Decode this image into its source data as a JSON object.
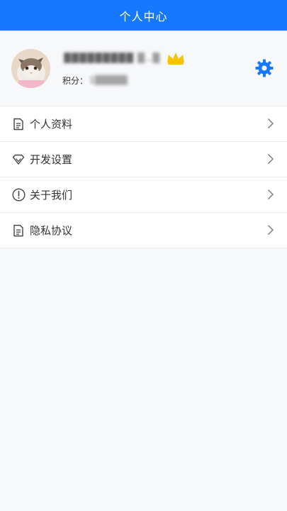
{
  "header": {
    "title": "个人中心",
    "color": "#1677ff"
  },
  "profile": {
    "username": "▓▓▓▓▓▓▓▓▓ ▒..▒",
    "points_label": "积分：",
    "points_value": "1▒▒▒▒▒",
    "vip_icon": "crown-icon",
    "settings_icon": "gear-icon"
  },
  "menu": {
    "items": [
      {
        "label": "个人资料",
        "icon": "document-icon"
      },
      {
        "label": "开发设置",
        "icon": "diamond-icon"
      },
      {
        "label": "关于我们",
        "icon": "info-icon"
      },
      {
        "label": "隐私协议",
        "icon": "document-icon"
      }
    ]
  }
}
